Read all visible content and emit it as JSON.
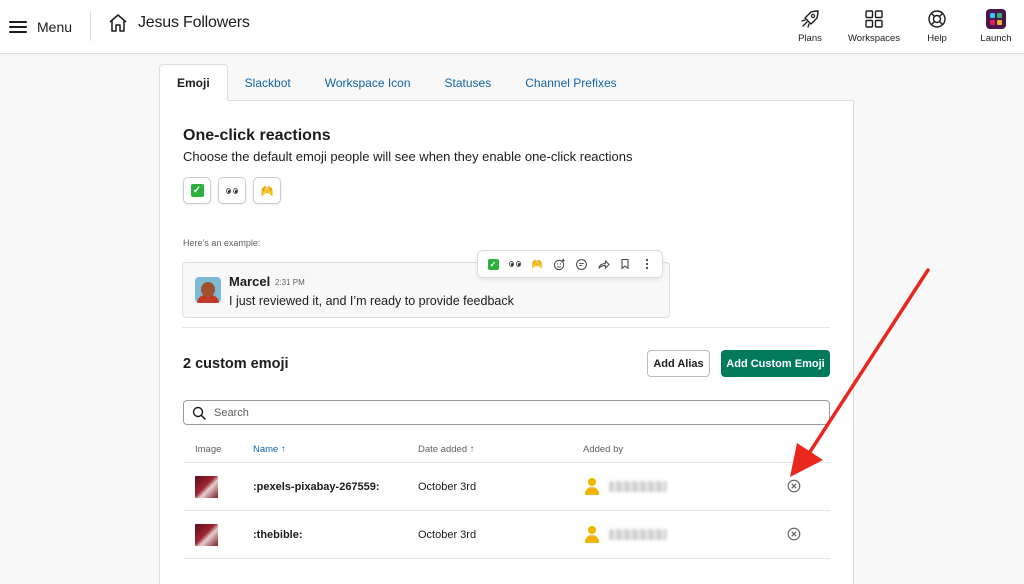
{
  "topbar": {
    "menu_label": "Menu",
    "workspace_name": "Jesus Followers",
    "actions": [
      {
        "label": "Plans",
        "icon": "rocket-icon"
      },
      {
        "label": "Workspaces",
        "icon": "grid-icon"
      },
      {
        "label": "Help",
        "icon": "lifebuoy-icon"
      },
      {
        "label": "Launch",
        "icon": "slack-logo-icon"
      }
    ]
  },
  "tabs": [
    {
      "label": "Emoji",
      "active": true
    },
    {
      "label": "Slackbot"
    },
    {
      "label": "Workspace Icon"
    },
    {
      "label": "Statuses"
    },
    {
      "label": "Channel Prefixes"
    }
  ],
  "one_click": {
    "title": "One-click reactions",
    "subtitle": "Choose the default emoji people will see when they enable one-click reactions",
    "reactions": [
      "white-check-mark",
      "eyes",
      "raised-hands"
    ]
  },
  "example": {
    "label": "Here’s an example:",
    "author": "Marcel",
    "time": "2:31 PM",
    "text": "I just reviewed it, and I’m ready to provide feedback"
  },
  "custom_emoji": {
    "title": "2 custom emoji",
    "add_alias_label": "Add Alias",
    "add_custom_label": "Add Custom Emoji",
    "search_placeholder": "Search",
    "columns": {
      "image": "Image",
      "name": "Name ↑",
      "date_added": "Date added ↑",
      "added_by": "Added by"
    },
    "rows": [
      {
        "name": ":pexels-pixabay-267559:",
        "date": "October 3rd"
      },
      {
        "name": ":thebible:",
        "date": "October 3rd"
      }
    ]
  },
  "colors": {
    "accent_link": "#1264a3",
    "primary_button": "#007a5a",
    "annotation_arrow": "#e8271f",
    "user_icon": "#f2b600"
  }
}
